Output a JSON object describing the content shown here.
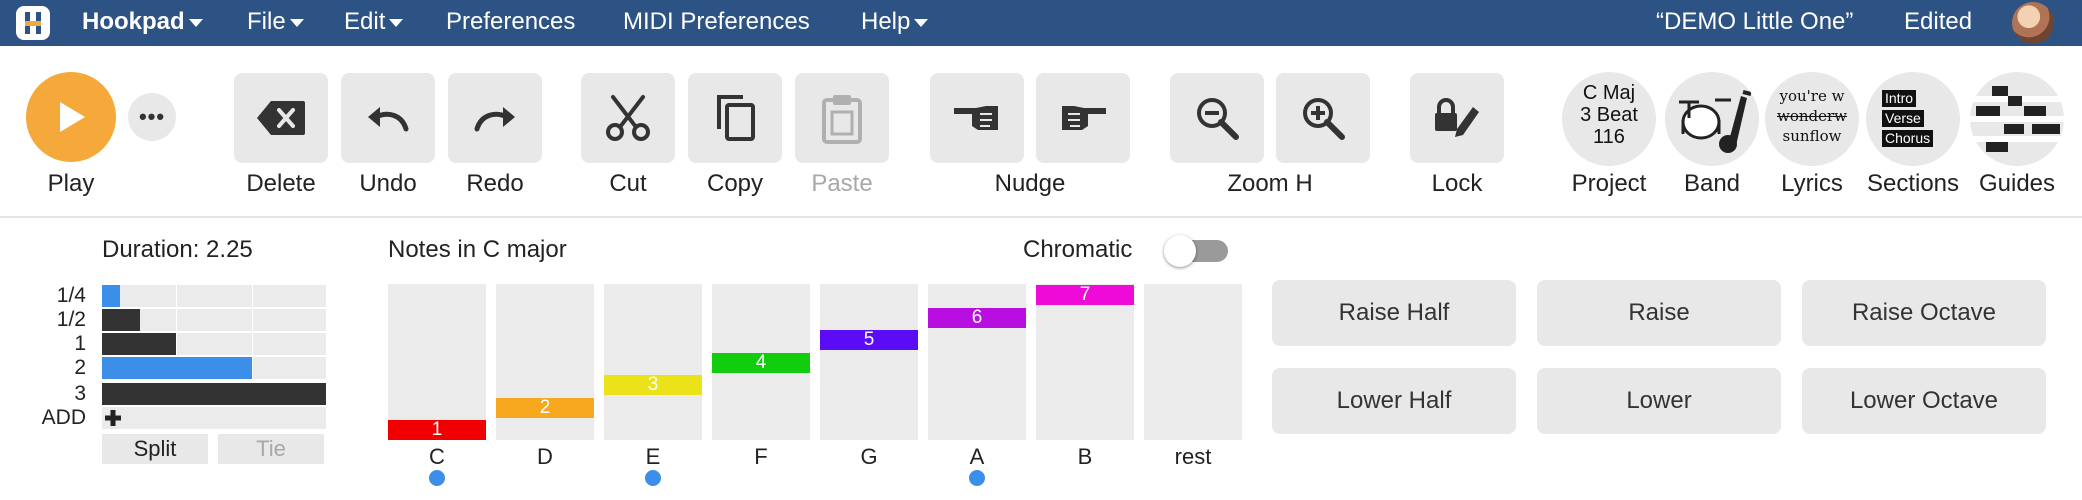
{
  "menubar": {
    "brand": "Hookpad",
    "items": [
      "File",
      "Edit",
      "Preferences",
      "MIDI Preferences",
      "Help"
    ],
    "song_title": "“DEMO Little One”",
    "status": "Edited"
  },
  "toolbar": {
    "play": "Play",
    "delete": "Delete",
    "undo": "Undo",
    "redo": "Redo",
    "cut": "Cut",
    "copy": "Copy",
    "paste": "Paste",
    "nudge": "Nudge",
    "zoom": "Zoom H",
    "lock": "Lock",
    "project": "Project",
    "band": "Band",
    "lyrics": "Lyrics",
    "sections": "Sections",
    "guides": "Guides",
    "project_key": "C Maj",
    "project_meter": "3 Beat",
    "project_tempo": "116",
    "lyric_lines": [
      "you're w",
      "wonderw",
      "sunflow"
    ],
    "section_names": [
      "Intro",
      "Verse",
      "Chorus"
    ]
  },
  "duration": {
    "title": "Duration: 2.25",
    "rows": [
      {
        "label": "1/4",
        "fill": 0.08,
        "color": "#3c8fe8"
      },
      {
        "label": "1/2",
        "fill": 0.17,
        "color": "#333333"
      },
      {
        "label": "1",
        "fill": 0.33,
        "color": "#333333"
      },
      {
        "label": "2",
        "fill": 0.67,
        "color": "#3c8fe8"
      },
      {
        "label": "3",
        "fill": 1.0,
        "color": "#333333"
      }
    ],
    "add_label": "ADD",
    "split": "Split",
    "tie": "Tie"
  },
  "notes": {
    "title": "Notes in C major",
    "chromatic": "Chromatic",
    "chromatic_on": false,
    "columns": [
      {
        "name": "C",
        "degree": "1",
        "color": "#f00000",
        "level": 1,
        "dot": true
      },
      {
        "name": "D",
        "degree": "2",
        "color": "#f8a81c",
        "level": 2,
        "dot": false
      },
      {
        "name": "E",
        "degree": "3",
        "color": "#ebe21a",
        "level": 3,
        "dot": true
      },
      {
        "name": "F",
        "degree": "4",
        "color": "#12cc0e",
        "level": 4,
        "dot": false
      },
      {
        "name": "G",
        "degree": "5",
        "color": "#5a0df5",
        "level": 5,
        "dot": false
      },
      {
        "name": "A",
        "degree": "6",
        "color": "#b80ee0",
        "level": 6,
        "dot": true
      },
      {
        "name": "B",
        "degree": "7",
        "color": "#f00ad8",
        "level": 7,
        "dot": false
      },
      {
        "name": "rest",
        "degree": "",
        "color": "",
        "level": 0,
        "dot": false
      }
    ]
  },
  "actions": {
    "raise_half": "Raise Half",
    "raise": "Raise",
    "raise_octave": "Raise Octave",
    "lower_half": "Lower Half",
    "lower": "Lower",
    "lower_octave": "Lower Octave"
  }
}
